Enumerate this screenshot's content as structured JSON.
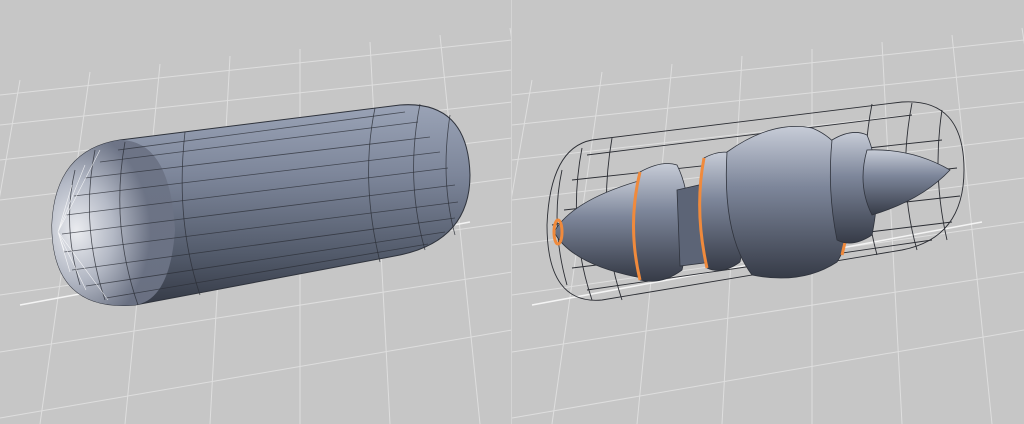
{
  "viewports": [
    {
      "name": "viewport-left",
      "object": "capsule-mesh",
      "mode": "solid-shaded"
    },
    {
      "name": "viewport-right",
      "object": "segmented-mesh-in-capsule-cage",
      "mode": "solid-shaded-with-wireframe-cage"
    }
  ],
  "colors": {
    "background": "#c6c6c6",
    "grid_line": "#dcdcdc",
    "grid_line_strong": "#efefef",
    "mesh_light": "#dfe2ea",
    "mesh_mid": "#7a8296",
    "mesh_dark": "#3b414f",
    "wire": "#2b2d33",
    "selection_orange": "#f08a3c"
  },
  "icons": []
}
